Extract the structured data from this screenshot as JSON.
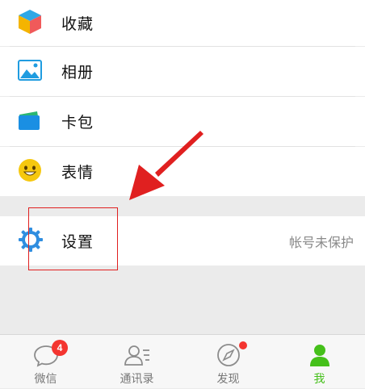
{
  "menu": {
    "favorites": {
      "label": "收藏",
      "icon": "favorites-cube-icon"
    },
    "album": {
      "label": "相册",
      "icon": "album-picture-icon"
    },
    "cards": {
      "label": "卡包",
      "icon": "card-wallet-icon"
    },
    "stickers": {
      "label": "表情",
      "icon": "smiley-face-icon"
    },
    "settings": {
      "label": "设置",
      "icon": "settings-gear-icon",
      "hint": "帐号未保护"
    }
  },
  "tabbar": {
    "tabs": [
      {
        "label": "微信",
        "icon": "chat-bubble-icon",
        "badge": "4"
      },
      {
        "label": "通讯录",
        "icon": "contacts-icon"
      },
      {
        "label": "发现",
        "icon": "discover-compass-icon",
        "dot": true
      },
      {
        "label": "我",
        "icon": "me-person-icon",
        "active": true
      }
    ]
  },
  "colors": {
    "accent_green": "#45c01a",
    "badge_red": "#f43530",
    "annotation_red": "#e02020"
  }
}
